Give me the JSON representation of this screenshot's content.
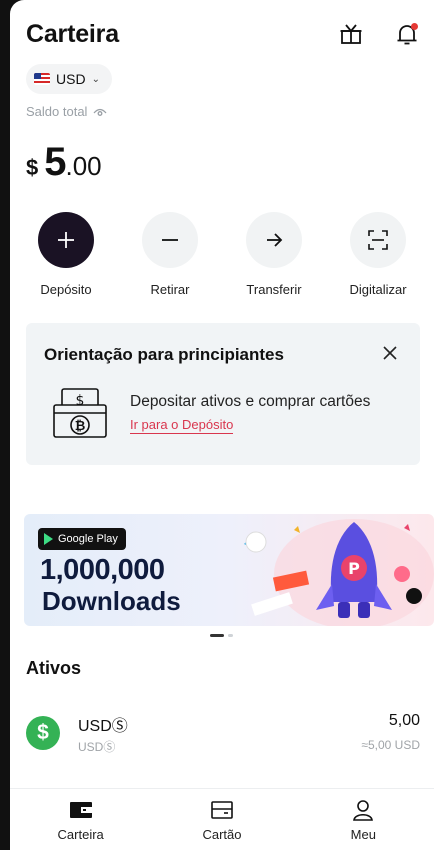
{
  "header": {
    "title": "Carteira"
  },
  "icons": {
    "gift": "gift-icon",
    "bell": "bell-icon"
  },
  "currency": {
    "selected": "USD"
  },
  "balance": {
    "label": "Saldo total",
    "currency_symbol": "$",
    "integer": "5",
    "decimal": ".00"
  },
  "actions": [
    {
      "label": "Depósito",
      "icon": "plus-icon"
    },
    {
      "label": "Retirar",
      "icon": "minus-icon"
    },
    {
      "label": "Transferir",
      "icon": "arrow-right-icon"
    },
    {
      "label": "Digitalizar",
      "icon": "scan-icon"
    }
  ],
  "guide": {
    "title": "Orientação para principiantes",
    "text": "Depositar ativos e comprar cartões",
    "link": "Ir para o Depósito"
  },
  "banner": {
    "badge": "Google Play",
    "number": "1,000,000",
    "text": "Downloads"
  },
  "assets": {
    "title": "Ativos",
    "items": [
      {
        "name": "USDⓈ",
        "sub": "USDⓈ",
        "amount": "5,00",
        "fiat": "≈5,00 USD"
      }
    ]
  },
  "nav": [
    {
      "label": "Carteira",
      "icon": "wallet-icon"
    },
    {
      "label": "Cartão",
      "icon": "card-icon"
    },
    {
      "label": "Meu",
      "icon": "user-icon"
    }
  ],
  "colors": {
    "primary": "#1a1224",
    "accent": "#d9364e",
    "asset_green": "#34b255"
  }
}
